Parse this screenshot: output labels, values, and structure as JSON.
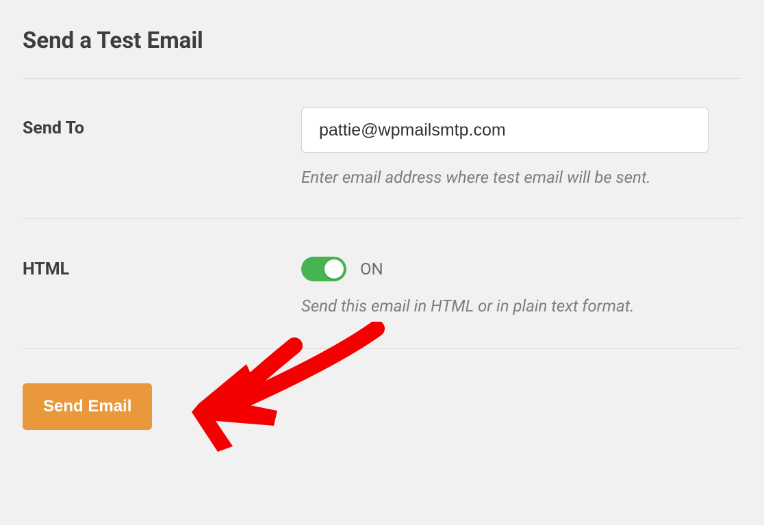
{
  "page": {
    "title": "Send a Test Email"
  },
  "form": {
    "sendTo": {
      "label": "Send To",
      "value": "pattie@wpmailsmtp.com",
      "help": "Enter email address where test email will be sent."
    },
    "html": {
      "label": "HTML",
      "state": "ON",
      "help": "Send this email in HTML or in plain text format."
    },
    "submit": {
      "label": "Send Email"
    }
  },
  "colors": {
    "toggleOn": "#46b450",
    "buttonBg": "#e9993c",
    "arrow": "#f40000"
  }
}
